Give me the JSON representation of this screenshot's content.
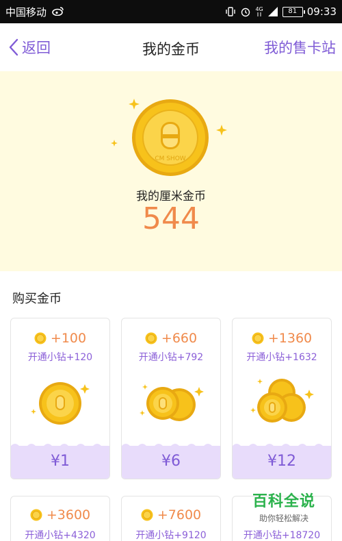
{
  "status_bar": {
    "carrier": "中国移动",
    "net_label": "4G",
    "battery": "81",
    "time": "09:33"
  },
  "nav": {
    "back_label": "返回",
    "title": "我的金币",
    "right_label": "我的售卡站"
  },
  "hero": {
    "label": "我的厘米金币",
    "value": "544",
    "coin_text": "CM SHOW"
  },
  "section": {
    "title": "购买金币"
  },
  "packages": [
    {
      "amount": "+100",
      "bonus": "开通小钻+120",
      "price": "¥1"
    },
    {
      "amount": "+660",
      "bonus": "开通小钻+792",
      "price": "¥6"
    },
    {
      "amount": "+1360",
      "bonus": "开通小钻+1632",
      "price": "¥12"
    },
    {
      "amount": "+3600",
      "bonus": "开通小钻+4320"
    },
    {
      "amount": "+7600",
      "bonus": "开通小钻+9120"
    },
    {
      "amount": "",
      "bonus": "开通小钻+18720"
    }
  ],
  "watermark": {
    "title": "百科全说",
    "subtitle": "助你轻松解决"
  },
  "colors": {
    "accent": "#7f5bd6",
    "orange": "#f08a4b",
    "hero_bg": "#fffbe0",
    "price_bg": "#e8dcfb",
    "coin": "#f7c21b"
  },
  "icons": {
    "back": "chevron-left-icon",
    "coin": "coin-icon",
    "sparkle": "sparkle-icon"
  }
}
